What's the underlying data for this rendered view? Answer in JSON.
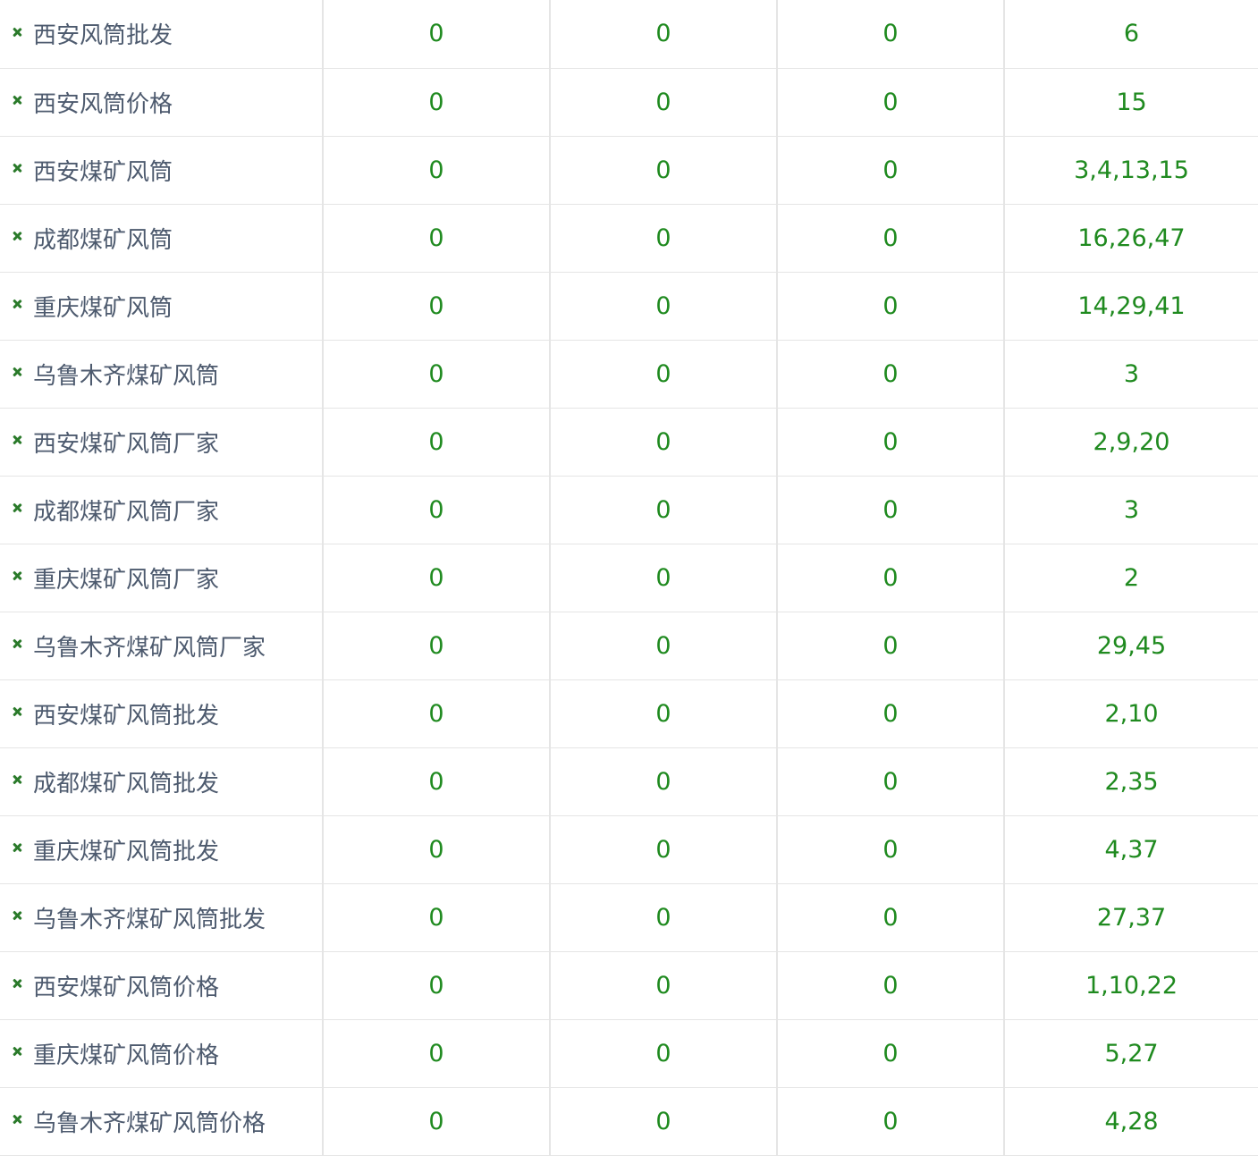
{
  "colors": {
    "keyword_text": "#4d5a6e",
    "value_text": "#1f8a1f",
    "delete_icon": "#2a7a2a",
    "grid_line": "#e5e5e5"
  },
  "delete_icon_name": "close-icon",
  "rows": [
    {
      "keyword": "西安风筒批发",
      "c1": "0",
      "c2": "0",
      "c3": "0",
      "ranks": "6"
    },
    {
      "keyword": "西安风筒价格",
      "c1": "0",
      "c2": "0",
      "c3": "0",
      "ranks": "15"
    },
    {
      "keyword": "西安煤矿风筒",
      "c1": "0",
      "c2": "0",
      "c3": "0",
      "ranks": "3,4,13,15"
    },
    {
      "keyword": "成都煤矿风筒",
      "c1": "0",
      "c2": "0",
      "c3": "0",
      "ranks": "16,26,47"
    },
    {
      "keyword": "重庆煤矿风筒",
      "c1": "0",
      "c2": "0",
      "c3": "0",
      "ranks": "14,29,41"
    },
    {
      "keyword": "乌鲁木齐煤矿风筒",
      "c1": "0",
      "c2": "0",
      "c3": "0",
      "ranks": "3"
    },
    {
      "keyword": "西安煤矿风筒厂家",
      "c1": "0",
      "c2": "0",
      "c3": "0",
      "ranks": "2,9,20"
    },
    {
      "keyword": "成都煤矿风筒厂家",
      "c1": "0",
      "c2": "0",
      "c3": "0",
      "ranks": "3"
    },
    {
      "keyword": "重庆煤矿风筒厂家",
      "c1": "0",
      "c2": "0",
      "c3": "0",
      "ranks": "2"
    },
    {
      "keyword": "乌鲁木齐煤矿风筒厂家",
      "c1": "0",
      "c2": "0",
      "c3": "0",
      "ranks": "29,45"
    },
    {
      "keyword": "西安煤矿风筒批发",
      "c1": "0",
      "c2": "0",
      "c3": "0",
      "ranks": "2,10"
    },
    {
      "keyword": "成都煤矿风筒批发",
      "c1": "0",
      "c2": "0",
      "c3": "0",
      "ranks": "2,35"
    },
    {
      "keyword": "重庆煤矿风筒批发",
      "c1": "0",
      "c2": "0",
      "c3": "0",
      "ranks": "4,37"
    },
    {
      "keyword": "乌鲁木齐煤矿风筒批发",
      "c1": "0",
      "c2": "0",
      "c3": "0",
      "ranks": "27,37"
    },
    {
      "keyword": "西安煤矿风筒价格",
      "c1": "0",
      "c2": "0",
      "c3": "0",
      "ranks": "1,10,22"
    },
    {
      "keyword": "重庆煤矿风筒价格",
      "c1": "0",
      "c2": "0",
      "c3": "0",
      "ranks": "5,27"
    },
    {
      "keyword": "乌鲁木齐煤矿风筒价格",
      "c1": "0",
      "c2": "0",
      "c3": "0",
      "ranks": "4,28"
    }
  ]
}
